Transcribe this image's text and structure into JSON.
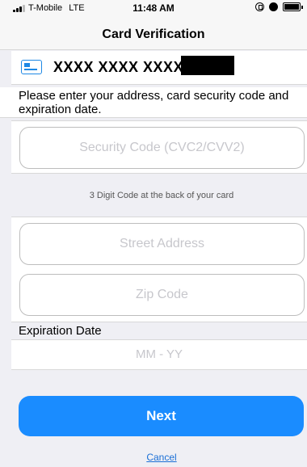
{
  "status_bar": {
    "carrier": "T-Mobile",
    "network": "LTE",
    "time": "11:48 AM"
  },
  "nav": {
    "title": "Card Verification"
  },
  "card": {
    "number_masked": "XXXX XXXX XXXX"
  },
  "instructions": "Please enter your address, card security code and expiration date.",
  "security_code": {
    "placeholder": "Security Code (CVC2/CVV2)",
    "hint": "3 Digit Code at the back of your card"
  },
  "address": {
    "street_placeholder": "Street Address",
    "zip_placeholder": "Zip Code"
  },
  "expiration": {
    "label": "Expiration Date",
    "placeholder": "MM - YY"
  },
  "actions": {
    "next_label": "Next",
    "cancel_label": "Cancel"
  },
  "colors": {
    "accent": "#1a8cff",
    "background": "#efeff4"
  }
}
